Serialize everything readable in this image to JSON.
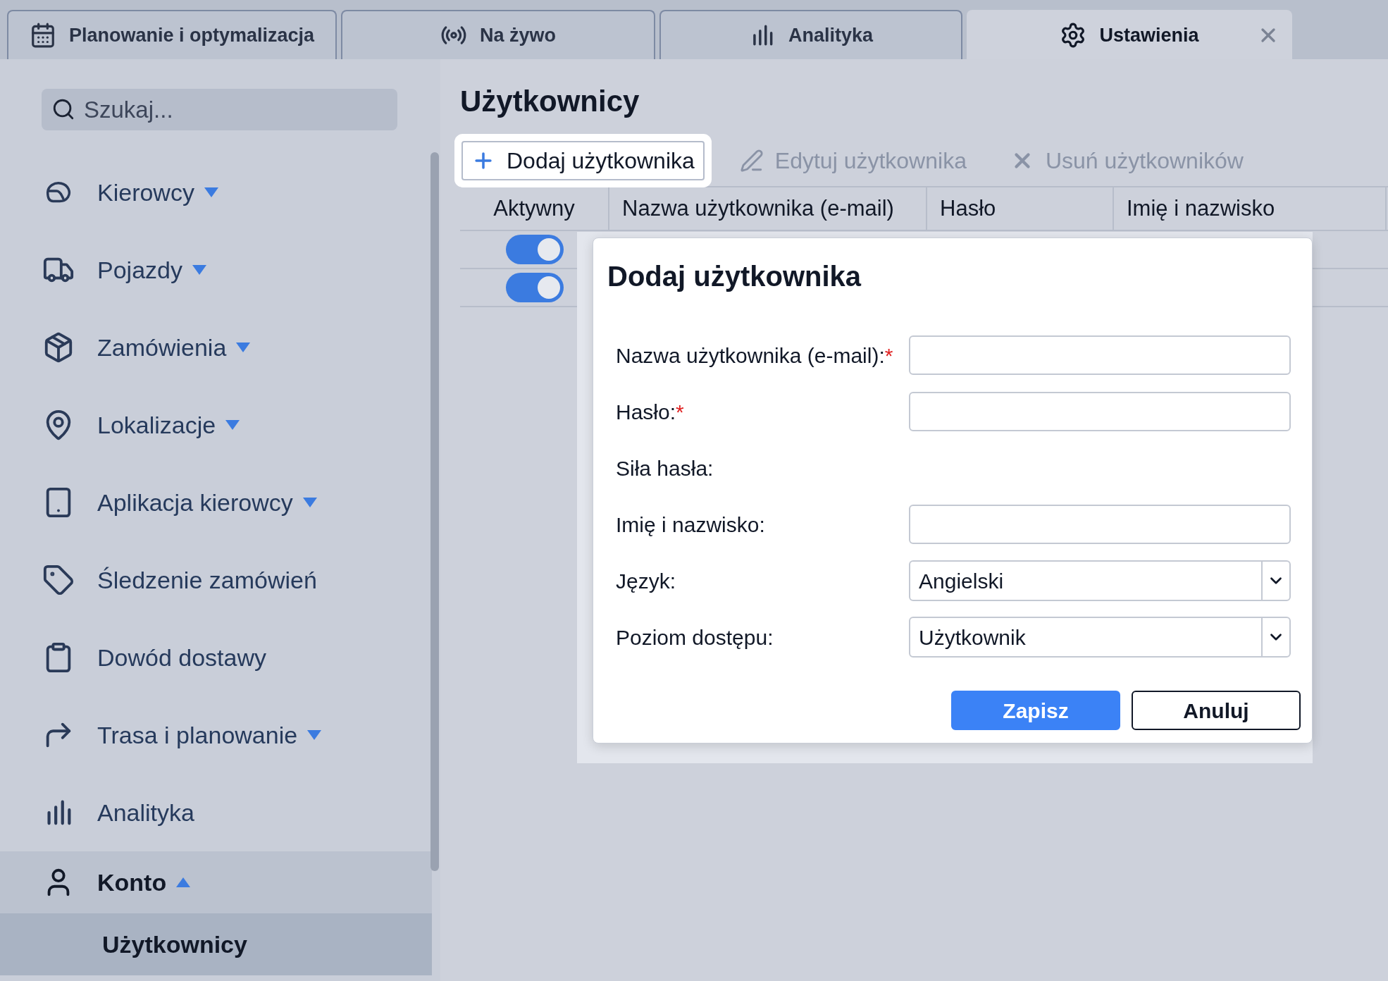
{
  "tabs": [
    {
      "label": "Planowanie i optymalizacja",
      "selected": false,
      "closable": false
    },
    {
      "label": "Na żywo",
      "selected": false,
      "closable": false
    },
    {
      "label": "Analityka",
      "selected": false,
      "closable": false
    },
    {
      "label": "Ustawienia",
      "selected": true,
      "closable": true
    }
  ],
  "sidebar": {
    "search": {
      "placeholder": "Szukaj..."
    },
    "items": [
      {
        "label": "Kierowcy",
        "expanded": false,
        "selected": false
      },
      {
        "label": "Pojazdy",
        "expanded": false,
        "selected": false
      },
      {
        "label": "Zamówienia",
        "expanded": false,
        "selected": false
      },
      {
        "label": "Lokalizacje",
        "expanded": false,
        "selected": false
      },
      {
        "label": "Aplikacja kierowcy",
        "expanded": false,
        "selected": false
      },
      {
        "label": "Śledzenie zamówień",
        "selected": false
      },
      {
        "label": "Dowód dostawy",
        "selected": false
      },
      {
        "label": "Trasa i planowanie",
        "expanded": false,
        "selected": false
      },
      {
        "label": "Analityka",
        "selected": false
      },
      {
        "label": "Konto",
        "expanded": true,
        "selected": true,
        "children": [
          {
            "label": "Użytkownicy",
            "selected": true
          }
        ]
      }
    ]
  },
  "page": {
    "title": "Użytkownicy",
    "toolbar": [
      {
        "label": "Dodaj użytkownika",
        "disabled": false
      },
      {
        "label": "Edytuj użytkownika",
        "disabled": true
      },
      {
        "label": "Usuń użytkowników",
        "disabled": true
      }
    ],
    "table": {
      "columns": [
        "Aktywny",
        "Nazwa użytkownika (e-mail)",
        "Hasło",
        "Imię i nazwisko"
      ],
      "rows": [
        {
          "active": true
        },
        {
          "active": true
        }
      ]
    }
  },
  "dialog": {
    "title": "Dodaj użytkownika",
    "fields": [
      {
        "kind": "text",
        "label": "Nazwa użytkownika (e-mail):",
        "required_mark": "*"
      },
      {
        "kind": "text",
        "label": "Hasło:",
        "required_mark": "*"
      },
      {
        "kind": "static",
        "label": "Siła hasła:"
      },
      {
        "kind": "text",
        "label": "Imię i nazwisko:"
      },
      {
        "kind": "select",
        "label": "Język:",
        "value": "Angielski"
      },
      {
        "kind": "select",
        "label": "Poziom dostępu:",
        "value": "Użytkownik"
      }
    ],
    "buttons": [
      {
        "label": "Zapisz",
        "primary": true
      },
      {
        "label": "Anuluj",
        "primary": false
      }
    ]
  }
}
